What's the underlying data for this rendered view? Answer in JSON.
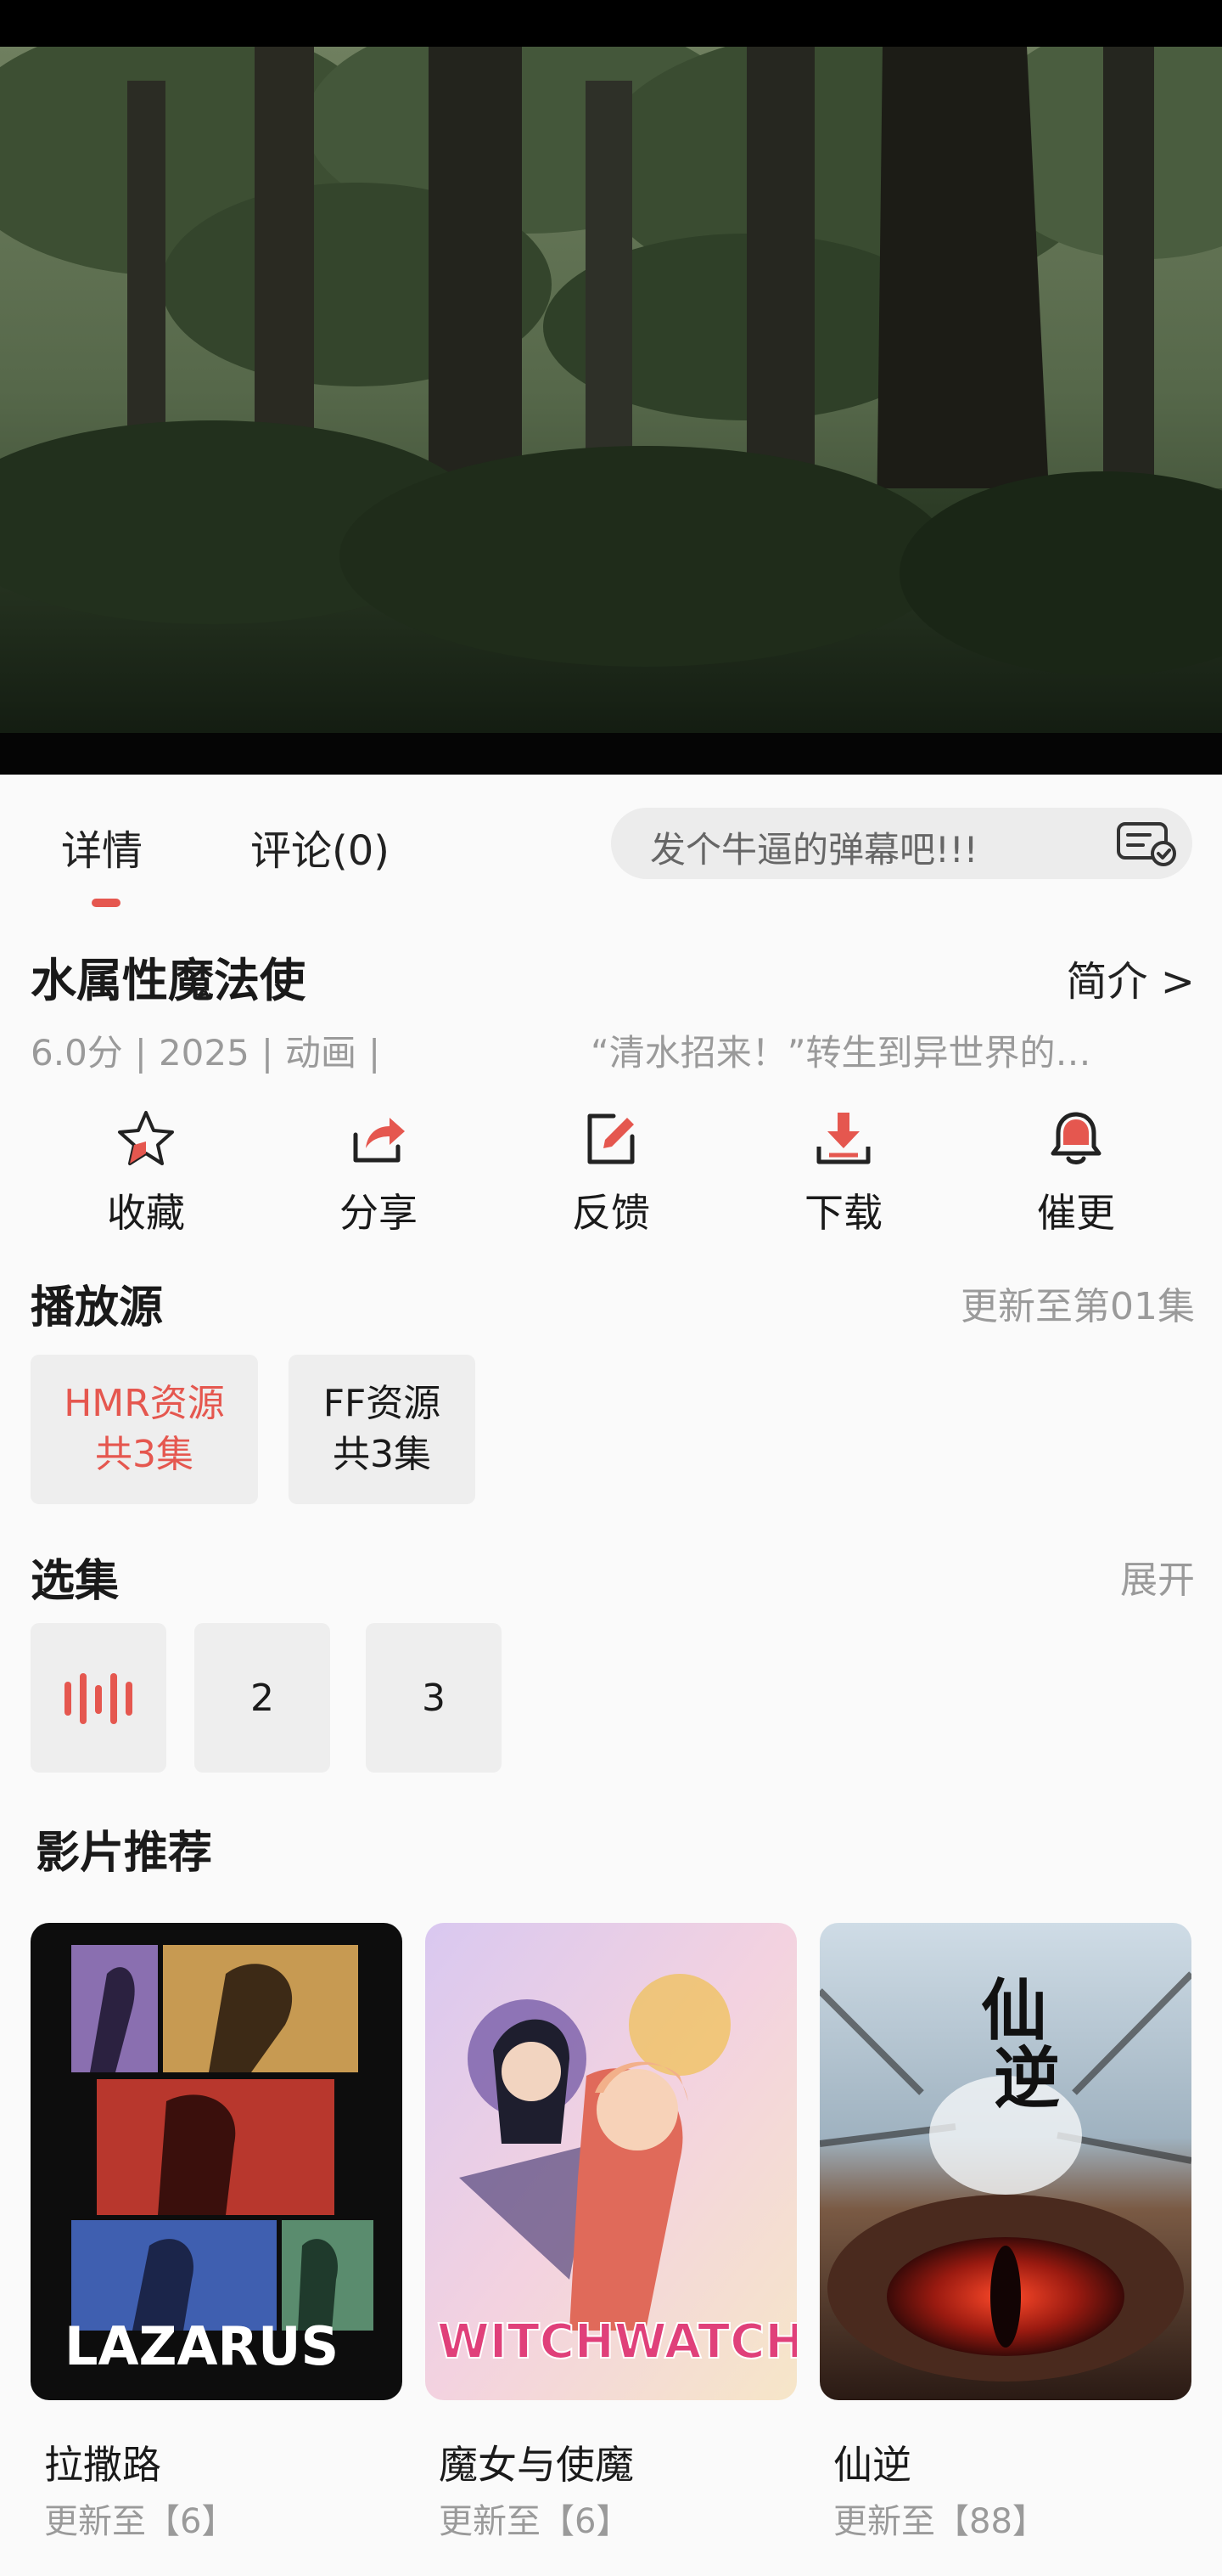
{
  "tabs": {
    "details": "详情",
    "comments": "评论(0)"
  },
  "danmaku": {
    "placeholder": "发个牛逼的弹幕吧!!!"
  },
  "show": {
    "title": "水属性魔法使",
    "intro_link": "简介 >",
    "score": "6.0分",
    "year": "2025",
    "category": "动画",
    "synopsis": "“清水招来！”转生到异世界的…"
  },
  "actions": [
    {
      "label": "收藏",
      "icon": "star-icon"
    },
    {
      "label": "分享",
      "icon": "share-icon"
    },
    {
      "label": "反馈",
      "icon": "feedback-icon"
    },
    {
      "label": "下载",
      "icon": "download-icon"
    },
    {
      "label": "催更",
      "icon": "bell-icon"
    }
  ],
  "sources": {
    "title": "播放源",
    "status": "更新至第01集",
    "items": [
      {
        "name": "HMR资源",
        "count": "共3集",
        "active": true
      },
      {
        "name": "FF资源",
        "count": "共3集",
        "active": false
      }
    ]
  },
  "episodes": {
    "title": "选集",
    "expand": "展开",
    "items": [
      "2",
      "3"
    ]
  },
  "recommend": {
    "title": "影片推荐",
    "items": [
      {
        "title": "拉撒路",
        "update": "更新至【6】",
        "poster_text": "LAZARUS"
      },
      {
        "title": "魔女与使魔",
        "update": "更新至【6】",
        "poster_text": "WITCHWATCH"
      },
      {
        "title": "仙逆",
        "update": "更新至【88】",
        "poster_text": "仙逆"
      }
    ]
  },
  "colors": {
    "accent": "#e5574f",
    "muted": "#9a9a9a",
    "chip_bg": "#eeeeee"
  }
}
